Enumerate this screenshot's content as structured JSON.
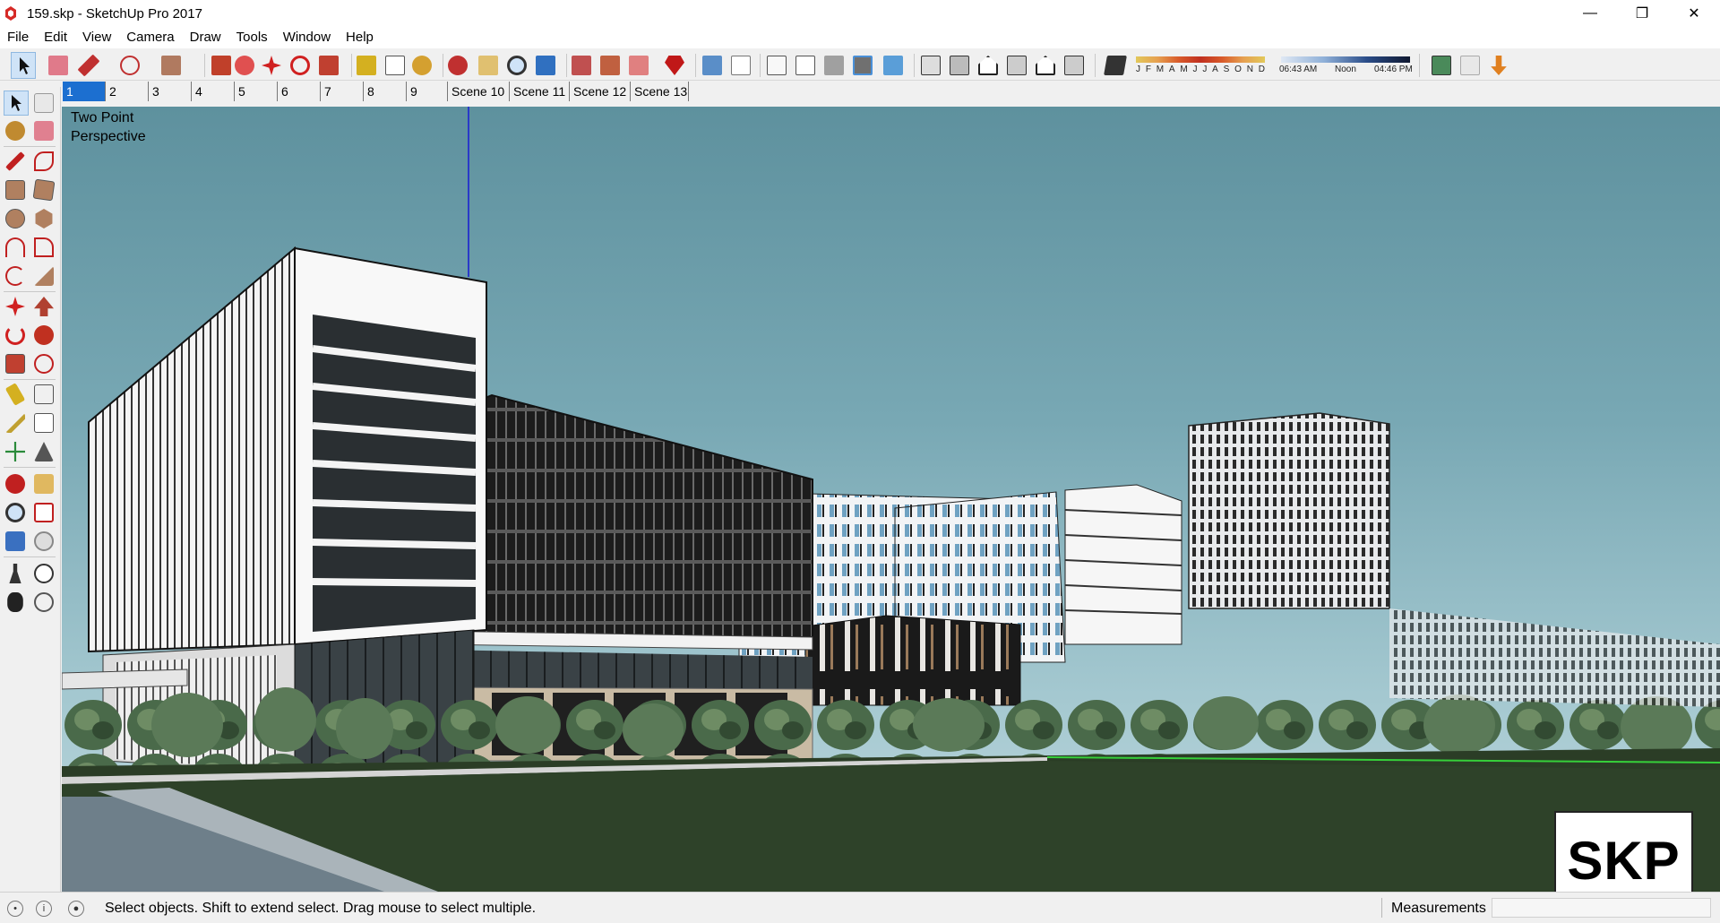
{
  "window": {
    "title": "159.skp - SketchUp Pro 2017",
    "minimize": "—",
    "restore": "❐",
    "close": "✕"
  },
  "menu": [
    "File",
    "Edit",
    "View",
    "Camera",
    "Draw",
    "Tools",
    "Window",
    "Help"
  ],
  "shadow_settings": {
    "months": [
      "J",
      "F",
      "M",
      "A",
      "M",
      "J",
      "J",
      "A",
      "S",
      "O",
      "N",
      "D"
    ],
    "sunrise": "06:43 AM",
    "noon": "Noon",
    "sunset": "04:46 PM"
  },
  "scenes": [
    {
      "label": "1",
      "active": true
    },
    {
      "label": "2"
    },
    {
      "label": "3"
    },
    {
      "label": "4"
    },
    {
      "label": "5"
    },
    {
      "label": "6"
    },
    {
      "label": "7"
    },
    {
      "label": "8"
    },
    {
      "label": "9"
    },
    {
      "label": "Scene 10"
    },
    {
      "label": "Scene 11"
    },
    {
      "label": "Scene 12"
    },
    {
      "label": "Scene 13"
    }
  ],
  "viewport": {
    "camera_label_line1": "Two Point",
    "camera_label_line2": "Perspective",
    "logo_text": "SKP",
    "sky_color": "#6b9ea9"
  },
  "statusbar": {
    "message": "Select objects. Shift to extend select. Drag mouse to select multiple.",
    "measurements_label": "Measurements",
    "measurements_value": ""
  },
  "colors": {
    "accent": "#1c6fd0",
    "tool_active": "#cfe3f7",
    "grass": "#2b3d26"
  }
}
